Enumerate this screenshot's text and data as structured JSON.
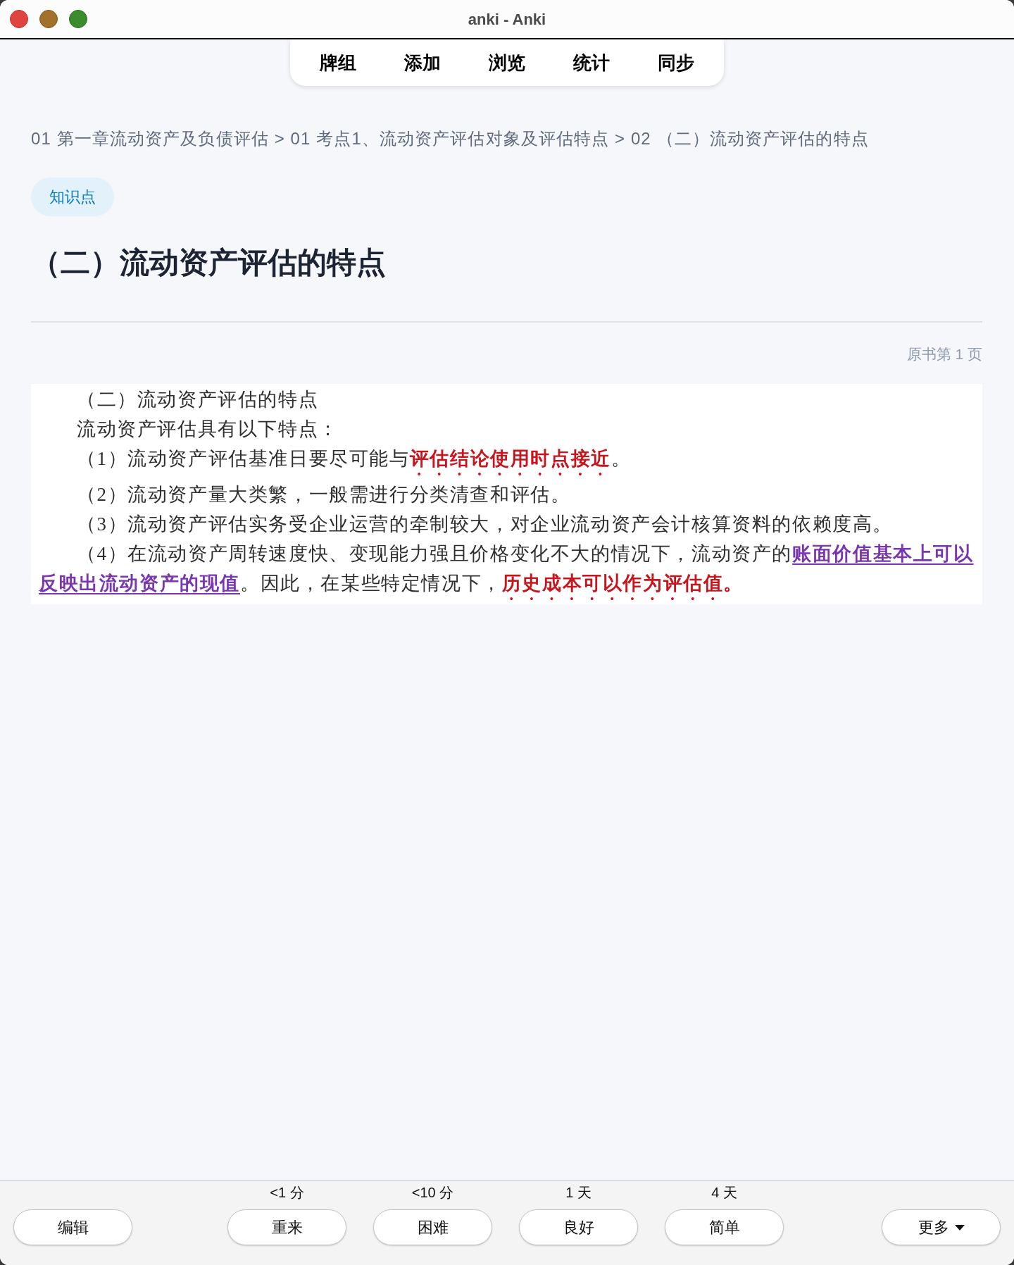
{
  "window": {
    "title": "anki - Anki"
  },
  "top_menu": [
    {
      "label": "牌组"
    },
    {
      "label": "添加"
    },
    {
      "label": "浏览"
    },
    {
      "label": "统计"
    },
    {
      "label": "同步"
    }
  ],
  "card": {
    "breadcrumb": "01 第一章流动资产及负债评估 > 01 考点1、流动资产评估对象及评估特点 > 02 （二）流动资产评估的特点",
    "tag": "知识点",
    "heading": "（二）流动资产评估的特点",
    "page_reference": "原书第 1 页",
    "document": {
      "paragraphs": [
        {
          "segments": [
            {
              "kind": "plain",
              "text": "（二）流动资产评估的特点"
            }
          ]
        },
        {
          "segments": [
            {
              "kind": "plain",
              "text": "流动资产评估具有以下特点："
            }
          ]
        },
        {
          "segments": [
            {
              "kind": "plain",
              "text": "（1）流动资产评估基准日要尽可能与"
            },
            {
              "kind": "emphasis",
              "text": "评估结论使用时点接近"
            },
            {
              "kind": "plain",
              "text": "。"
            }
          ]
        },
        {
          "segments": [
            {
              "kind": "plain",
              "text": "（2）流动资产量大类繁，一般需进行分类清查和评估。"
            }
          ]
        },
        {
          "segments": [
            {
              "kind": "plain",
              "text": "（3）流动资产评估实务受企业运营的牵制较大，对企业流动资产会计核算资料的依赖度高。"
            }
          ]
        },
        {
          "segments": [
            {
              "kind": "plain",
              "text": "（4）在流动资产周转速度快、变现能力强且价格变化不大的情况下，流动资产的"
            },
            {
              "kind": "underline",
              "text": "账面价值基本上可以反映出流动资产的现值"
            },
            {
              "kind": "plain",
              "text": "。因此，在某些特定情况下，"
            },
            {
              "kind": "emphasis",
              "text": "历史成本可以作为评估值。"
            }
          ]
        }
      ]
    }
  },
  "answer_bar": {
    "edit_button": "编辑",
    "answers": [
      {
        "interval": "<1 分",
        "label": "重来"
      },
      {
        "interval": "<10 分",
        "label": "困难"
      },
      {
        "interval": "1 天",
        "label": "良好"
      },
      {
        "interval": "4 天",
        "label": "简单"
      }
    ],
    "more_button": "更多"
  }
}
